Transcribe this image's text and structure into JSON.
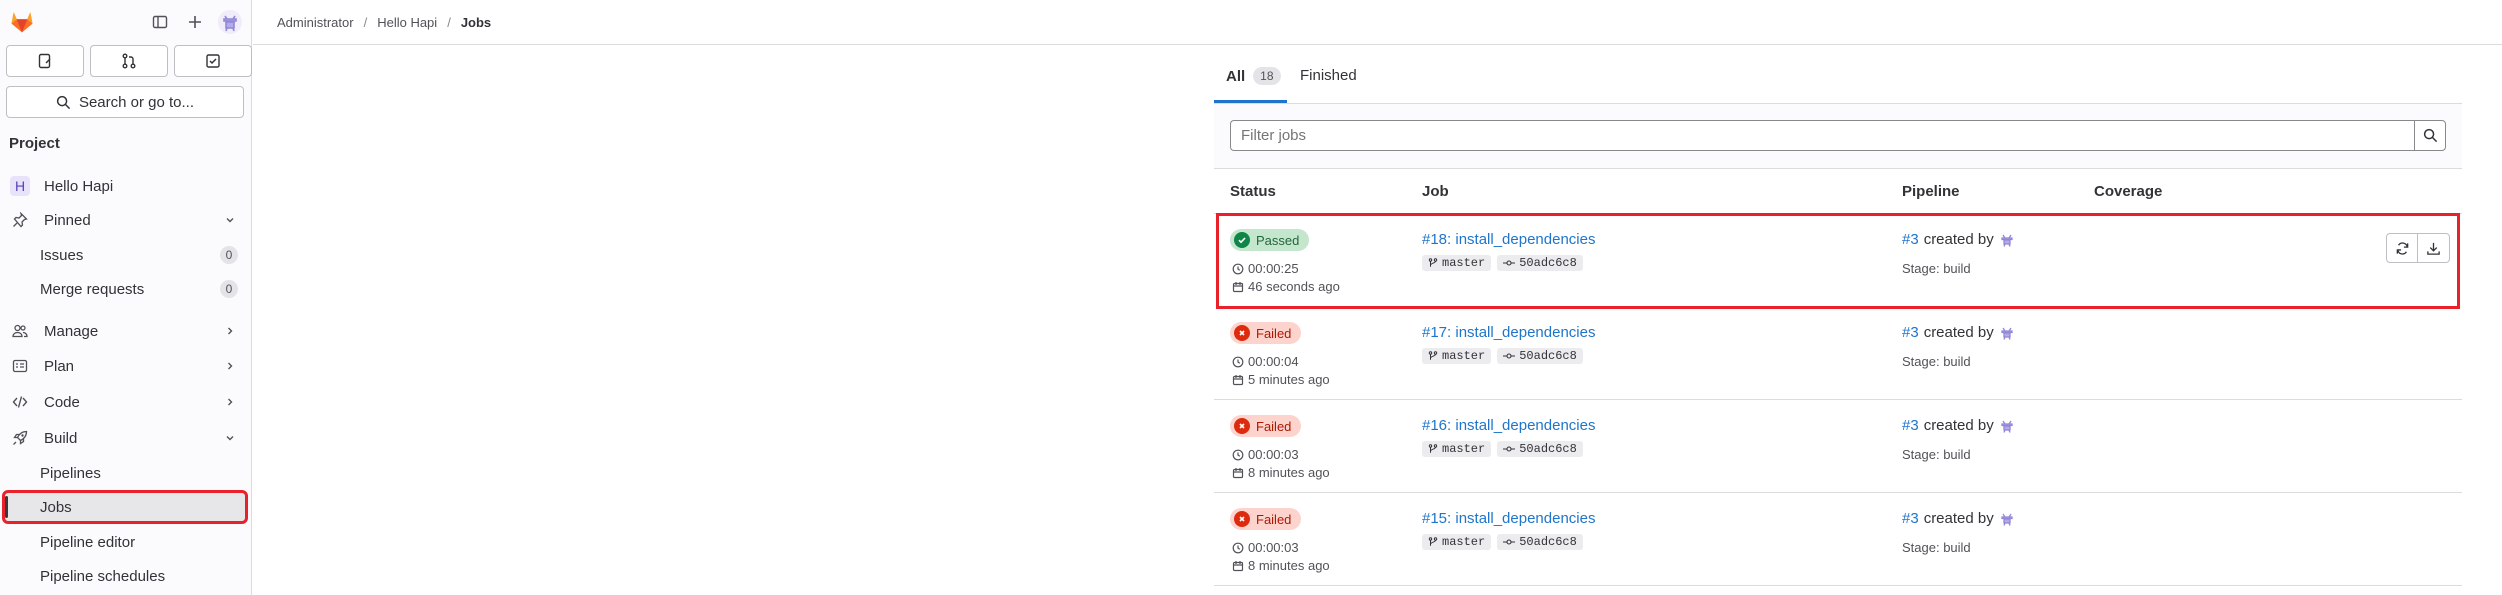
{
  "breadcrumb": [
    "Administrator",
    "Hello Hapi",
    "Jobs"
  ],
  "sidebar": {
    "search_label": "Search or go to...",
    "section_title": "Project",
    "project_name": "Hello Hapi",
    "project_initial": "H",
    "items": {
      "pinned": "Pinned",
      "issues": "Issues",
      "issues_count": "0",
      "merge_requests": "Merge requests",
      "merge_requests_count": "0",
      "manage": "Manage",
      "plan": "Plan",
      "code": "Code",
      "build": "Build",
      "pipelines": "Pipelines",
      "jobs": "Jobs",
      "pipeline_editor": "Pipeline editor",
      "pipeline_schedules": "Pipeline schedules"
    }
  },
  "tabs": {
    "all_label": "All",
    "all_count": "18",
    "finished_label": "Finished"
  },
  "filter": {
    "placeholder": "Filter jobs"
  },
  "table": {
    "headers": {
      "status": "Status",
      "job": "Job",
      "pipeline": "Pipeline",
      "coverage": "Coverage"
    },
    "rows": [
      {
        "status": "Passed",
        "duration": "00:00:25",
        "finished": "46 seconds ago",
        "job": "#18: install_dependencies",
        "branch": "master",
        "commit": "50adc6c8",
        "pipeline": "#3",
        "created_by": "created by",
        "stage": "Stage: build"
      },
      {
        "status": "Failed",
        "duration": "00:00:04",
        "finished": "5 minutes ago",
        "job": "#17: install_dependencies",
        "branch": "master",
        "commit": "50adc6c8",
        "pipeline": "#3",
        "created_by": "created by",
        "stage": "Stage: build"
      },
      {
        "status": "Failed",
        "duration": "00:00:03",
        "finished": "8 minutes ago",
        "job": "#16: install_dependencies",
        "branch": "master",
        "commit": "50adc6c8",
        "pipeline": "#3",
        "created_by": "created by",
        "stage": "Stage: build"
      },
      {
        "status": "Failed",
        "duration": "00:00:03",
        "finished": "8 minutes ago",
        "job": "#15: install_dependencies",
        "branch": "master",
        "commit": "50adc6c8",
        "pipeline": "#3",
        "created_by": "created by",
        "stage": "Stage: build"
      }
    ]
  },
  "colors": {
    "accent": "#1f75cb",
    "highlight": "#e8212b",
    "passed": "#108548",
    "failed": "#dd2b0e"
  }
}
